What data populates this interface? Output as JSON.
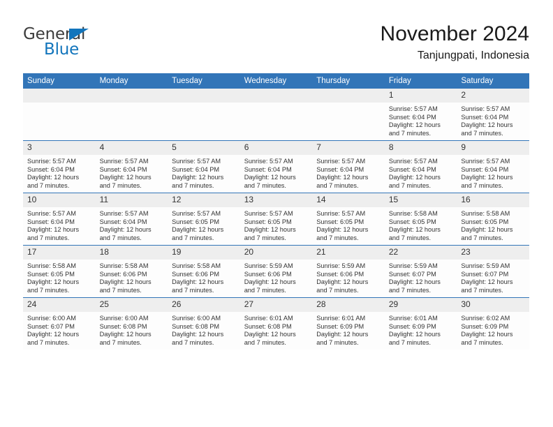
{
  "logo": {
    "word_one": "General",
    "word_two": "Blue",
    "triangle_icon": "blue-triangle-icon",
    "brand_color": "#1275bc",
    "text_color": "#3c3c3c"
  },
  "header": {
    "title": "November 2024",
    "subtitle": "Tanjungpati, Indonesia"
  },
  "theme": {
    "header_blue": "#3275b8",
    "daynum_band": "#eeeeee",
    "cell_bg": "#fdfdfd",
    "text": "#333333"
  },
  "calendar": {
    "weekday_headers": [
      "Sunday",
      "Monday",
      "Tuesday",
      "Wednesday",
      "Thursday",
      "Friday",
      "Saturday"
    ],
    "labels": {
      "sunrise_prefix": "Sunrise:",
      "sunset_prefix": "Sunset:",
      "daylight_prefix": "Daylight:"
    },
    "weeks": [
      [
        {
          "day": "",
          "empty": true,
          "line1": "",
          "line2": "",
          "line3": "",
          "line4": ""
        },
        {
          "day": "",
          "empty": true,
          "line1": "",
          "line2": "",
          "line3": "",
          "line4": ""
        },
        {
          "day": "",
          "empty": true,
          "line1": "",
          "line2": "",
          "line3": "",
          "line4": ""
        },
        {
          "day": "",
          "empty": true,
          "line1": "",
          "line2": "",
          "line3": "",
          "line4": ""
        },
        {
          "day": "",
          "empty": true,
          "line1": "",
          "line2": "",
          "line3": "",
          "line4": ""
        },
        {
          "day": "1",
          "empty": false,
          "line1": "Sunrise: 5:57 AM",
          "line2": "Sunset: 6:04 PM",
          "line3": "Daylight: 12 hours",
          "line4": "and 7 minutes."
        },
        {
          "day": "2",
          "empty": false,
          "line1": "Sunrise: 5:57 AM",
          "line2": "Sunset: 6:04 PM",
          "line3": "Daylight: 12 hours",
          "line4": "and 7 minutes."
        }
      ],
      [
        {
          "day": "3",
          "empty": false,
          "line1": "Sunrise: 5:57 AM",
          "line2": "Sunset: 6:04 PM",
          "line3": "Daylight: 12 hours",
          "line4": "and 7 minutes."
        },
        {
          "day": "4",
          "empty": false,
          "line1": "Sunrise: 5:57 AM",
          "line2": "Sunset: 6:04 PM",
          "line3": "Daylight: 12 hours",
          "line4": "and 7 minutes."
        },
        {
          "day": "5",
          "empty": false,
          "line1": "Sunrise: 5:57 AM",
          "line2": "Sunset: 6:04 PM",
          "line3": "Daylight: 12 hours",
          "line4": "and 7 minutes."
        },
        {
          "day": "6",
          "empty": false,
          "line1": "Sunrise: 5:57 AM",
          "line2": "Sunset: 6:04 PM",
          "line3": "Daylight: 12 hours",
          "line4": "and 7 minutes."
        },
        {
          "day": "7",
          "empty": false,
          "line1": "Sunrise: 5:57 AM",
          "line2": "Sunset: 6:04 PM",
          "line3": "Daylight: 12 hours",
          "line4": "and 7 minutes."
        },
        {
          "day": "8",
          "empty": false,
          "line1": "Sunrise: 5:57 AM",
          "line2": "Sunset: 6:04 PM",
          "line3": "Daylight: 12 hours",
          "line4": "and 7 minutes."
        },
        {
          "day": "9",
          "empty": false,
          "line1": "Sunrise: 5:57 AM",
          "line2": "Sunset: 6:04 PM",
          "line3": "Daylight: 12 hours",
          "line4": "and 7 minutes."
        }
      ],
      [
        {
          "day": "10",
          "empty": false,
          "line1": "Sunrise: 5:57 AM",
          "line2": "Sunset: 6:04 PM",
          "line3": "Daylight: 12 hours",
          "line4": "and 7 minutes."
        },
        {
          "day": "11",
          "empty": false,
          "line1": "Sunrise: 5:57 AM",
          "line2": "Sunset: 6:04 PM",
          "line3": "Daylight: 12 hours",
          "line4": "and 7 minutes."
        },
        {
          "day": "12",
          "empty": false,
          "line1": "Sunrise: 5:57 AM",
          "line2": "Sunset: 6:05 PM",
          "line3": "Daylight: 12 hours",
          "line4": "and 7 minutes."
        },
        {
          "day": "13",
          "empty": false,
          "line1": "Sunrise: 5:57 AM",
          "line2": "Sunset: 6:05 PM",
          "line3": "Daylight: 12 hours",
          "line4": "and 7 minutes."
        },
        {
          "day": "14",
          "empty": false,
          "line1": "Sunrise: 5:57 AM",
          "line2": "Sunset: 6:05 PM",
          "line3": "Daylight: 12 hours",
          "line4": "and 7 minutes."
        },
        {
          "day": "15",
          "empty": false,
          "line1": "Sunrise: 5:58 AM",
          "line2": "Sunset: 6:05 PM",
          "line3": "Daylight: 12 hours",
          "line4": "and 7 minutes."
        },
        {
          "day": "16",
          "empty": false,
          "line1": "Sunrise: 5:58 AM",
          "line2": "Sunset: 6:05 PM",
          "line3": "Daylight: 12 hours",
          "line4": "and 7 minutes."
        }
      ],
      [
        {
          "day": "17",
          "empty": false,
          "line1": "Sunrise: 5:58 AM",
          "line2": "Sunset: 6:05 PM",
          "line3": "Daylight: 12 hours",
          "line4": "and 7 minutes."
        },
        {
          "day": "18",
          "empty": false,
          "line1": "Sunrise: 5:58 AM",
          "line2": "Sunset: 6:06 PM",
          "line3": "Daylight: 12 hours",
          "line4": "and 7 minutes."
        },
        {
          "day": "19",
          "empty": false,
          "line1": "Sunrise: 5:58 AM",
          "line2": "Sunset: 6:06 PM",
          "line3": "Daylight: 12 hours",
          "line4": "and 7 minutes."
        },
        {
          "day": "20",
          "empty": false,
          "line1": "Sunrise: 5:59 AM",
          "line2": "Sunset: 6:06 PM",
          "line3": "Daylight: 12 hours",
          "line4": "and 7 minutes."
        },
        {
          "day": "21",
          "empty": false,
          "line1": "Sunrise: 5:59 AM",
          "line2": "Sunset: 6:06 PM",
          "line3": "Daylight: 12 hours",
          "line4": "and 7 minutes."
        },
        {
          "day": "22",
          "empty": false,
          "line1": "Sunrise: 5:59 AM",
          "line2": "Sunset: 6:07 PM",
          "line3": "Daylight: 12 hours",
          "line4": "and 7 minutes."
        },
        {
          "day": "23",
          "empty": false,
          "line1": "Sunrise: 5:59 AM",
          "line2": "Sunset: 6:07 PM",
          "line3": "Daylight: 12 hours",
          "line4": "and 7 minutes."
        }
      ],
      [
        {
          "day": "24",
          "empty": false,
          "line1": "Sunrise: 6:00 AM",
          "line2": "Sunset: 6:07 PM",
          "line3": "Daylight: 12 hours",
          "line4": "and 7 minutes."
        },
        {
          "day": "25",
          "empty": false,
          "line1": "Sunrise: 6:00 AM",
          "line2": "Sunset: 6:08 PM",
          "line3": "Daylight: 12 hours",
          "line4": "and 7 minutes."
        },
        {
          "day": "26",
          "empty": false,
          "line1": "Sunrise: 6:00 AM",
          "line2": "Sunset: 6:08 PM",
          "line3": "Daylight: 12 hours",
          "line4": "and 7 minutes."
        },
        {
          "day": "27",
          "empty": false,
          "line1": "Sunrise: 6:01 AM",
          "line2": "Sunset: 6:08 PM",
          "line3": "Daylight: 12 hours",
          "line4": "and 7 minutes."
        },
        {
          "day": "28",
          "empty": false,
          "line1": "Sunrise: 6:01 AM",
          "line2": "Sunset: 6:09 PM",
          "line3": "Daylight: 12 hours",
          "line4": "and 7 minutes."
        },
        {
          "day": "29",
          "empty": false,
          "line1": "Sunrise: 6:01 AM",
          "line2": "Sunset: 6:09 PM",
          "line3": "Daylight: 12 hours",
          "line4": "and 7 minutes."
        },
        {
          "day": "30",
          "empty": false,
          "line1": "Sunrise: 6:02 AM",
          "line2": "Sunset: 6:09 PM",
          "line3": "Daylight: 12 hours",
          "line4": "and 7 minutes."
        }
      ]
    ]
  }
}
